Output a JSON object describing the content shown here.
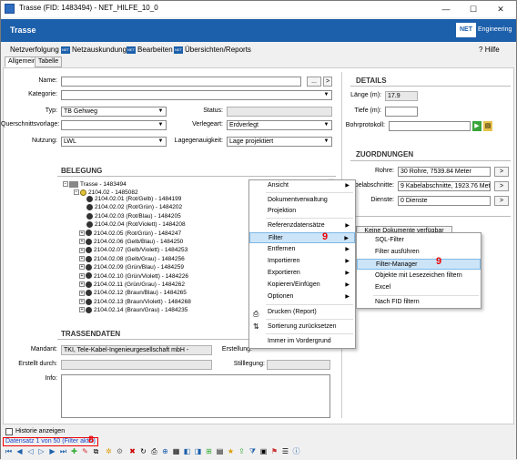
{
  "window": {
    "title": "Trasse (FID: 1483494) - NET_HILFE_10_0",
    "minimize": "—",
    "maximize": "☐",
    "close": "✕"
  },
  "header": {
    "title": "Trasse",
    "logo": "NET",
    "logo_sub": "Engineering"
  },
  "menu": {
    "items": [
      "Netzverfolgung",
      "Netzauskundung",
      "Bearbeiten",
      "Übersichten/Reports"
    ],
    "help": "Hilfe"
  },
  "tabs": [
    "Allgemein",
    "Tabelle"
  ],
  "form": {
    "name_label": "Name:",
    "name_value": "",
    "kategorie_label": "Kategorie:",
    "kategorie_value": "",
    "typ_label": "Typ:",
    "typ_value": "TB Gehweg",
    "status_label": "Status:",
    "status_value": "",
    "qv_label": "Querschnittsvorlage:",
    "qv_value": "",
    "verlegeart_label": "Verlegeart:",
    "verlegeart_value": "Erdverlegt",
    "nutzung_label": "Nutzung:",
    "nutzung_value": "LWL",
    "lagegenauigkeit_label": "Lagegenauigkeit:",
    "lagegenauigkeit_value": "Lage projektiert",
    "more_btn": "..."
  },
  "details": {
    "title": "DETAILS",
    "laenge_label": "Länge (m):",
    "laenge_value": "17.9",
    "tiefe_label": "Tiefe (m):",
    "tiefe_value": "",
    "bohr_label": "Bohrprotokoll:",
    "bohr_value": ""
  },
  "zuordnungen": {
    "title": "ZUORDNUNGEN",
    "rohre_label": "Rohre:",
    "rohre_value": "30 Rohre, 7539.84 Meter",
    "kabel_label": "Kabelabschnitte:",
    "kabel_value": "9 Kabelabschnitte, 1923.76 Meter",
    "dienste_label": "Dienste:",
    "dienste_value": "0 Dienste",
    "btn": ">",
    "doc_btn": "Keine Dokumente verfügbar"
  },
  "belegung": {
    "title": "BELEGUNG",
    "root": "Trasse - 1483494",
    "sub": "2104.02 - 1485082",
    "rows": [
      "2104.02.01 (Rot/Gelb) - 1484199",
      "2104.02.02 (Rot/Grün) - 1484202",
      "2104.02.03 (Rot/Blau) - 1484205",
      "2104.02.04 (Rot/Violett) - 1484208",
      "2104.02.05 (Rot/Grün) - 1484247",
      "2104.02.06 (Gelb/Blau) - 1484250",
      "2104.02.07 (Gelb/Violett) - 1484253",
      "2104.02.08 (Gelb/Grau) - 1484256",
      "2104.02.09 (Grün/Blau) - 1484259",
      "2104.02.10 (Grün/Violett) - 1484226",
      "2104.02.11 (Grün/Grau) - 1484262",
      "2104.02.12 (Braun/Blau) - 1484265",
      "2104.02.13 (Braun/Violett) - 1484268",
      "2104.02.14 (Braun/Grau) - 1484235"
    ]
  },
  "trassendaten": {
    "title": "TRASSENDATEN",
    "mandant_label": "Mandant:",
    "mandant_value": "TKI, Tele-Kabel-Ingenieurgesellschaft mbH -",
    "erstellt_label": "Erstellt durch:",
    "erstellt_value": "",
    "info_label": "Info:",
    "info_value": "",
    "erstellung_label": "Erstellung:",
    "stilllegung_label": "Stilllegung:"
  },
  "context_menu": {
    "items": [
      "Ansicht",
      "Dokumentverwaltung",
      "Projektion",
      "Referenzdatensätze",
      "Filter",
      "Entfernen",
      "Importieren",
      "Exportieren",
      "Kopieren/Einfügen",
      "Optionen",
      "Drucken (Report)",
      "Sortierung zurücksetzen",
      "Immer im Vordergrund"
    ]
  },
  "filter_submenu": {
    "items": [
      "SQL-Filter",
      "Filter ausführen",
      "Filter-Manager",
      "Objekte mit Lesezeichen filtern",
      "Excel",
      "Nach FID filtern"
    ]
  },
  "markers": {
    "nine_a": "9",
    "nine_b": "9",
    "eight": "8"
  },
  "footer": {
    "historie": "Historie anzeigen",
    "status": "Datensatz 1 von 50 (Filter aktiv)"
  }
}
